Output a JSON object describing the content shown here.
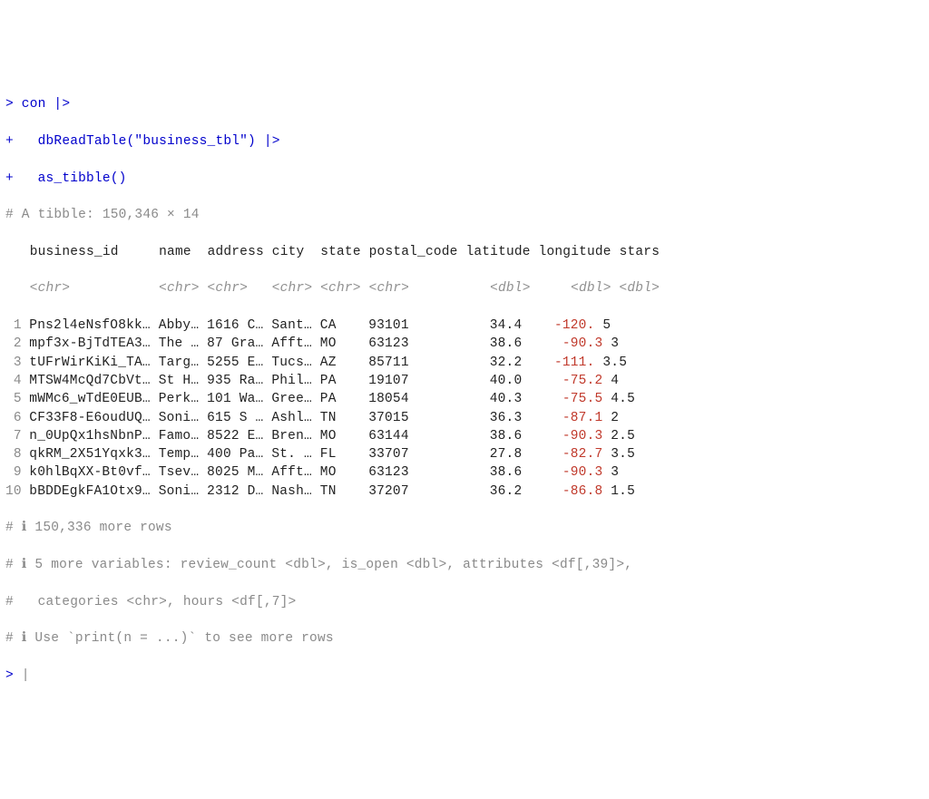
{
  "input": {
    "prompt1": ">",
    "line1": " con |>",
    "prompt2": "+",
    "line2": "   dbReadTable(\"business_tbl\") |>",
    "prompt3": "+",
    "line3": "   as_tibble()"
  },
  "header": {
    "tibble": "# A tibble: 150,346 × 14",
    "cols": {
      "gap0": "   ",
      "business_id": "business_id    ",
      "name": " name ",
      "address": " address",
      "city": " city ",
      "state": " state",
      "postal_code": " postal_code",
      "latitude": " latitude",
      "longitude": " longitude",
      "stars": " stars"
    },
    "types_full": "   <chr>           <chr> <chr>   <chr> <chr> <chr>          <dbl>     <dbl> <dbl>"
  },
  "rows": [
    {
      "n": " 1",
      "biz": " Pns2l4eNsfO8kk…",
      "name": " Abby…",
      "addr": " 1616 C…",
      "city": " Sant…",
      "state": " CA   ",
      "post": " 93101      ",
      "lat": "    34.4",
      "lon": "    -120.",
      "lonneg": true,
      "stars": " 5  "
    },
    {
      "n": " 2",
      "biz": " mpf3x-BjTdTEA3…",
      "name": " The …",
      "addr": " 87 Gra…",
      "city": " Afft…",
      "state": " MO   ",
      "post": " 63123      ",
      "lat": "    38.6",
      "lon": "     -90.3",
      "lonneg": true,
      "stars": " 3  "
    },
    {
      "n": " 3",
      "biz": " tUFrWirKiKi_TA…",
      "name": " Targ…",
      "addr": " 5255 E…",
      "city": " Tucs…",
      "state": " AZ   ",
      "post": " 85711      ",
      "lat": "    32.2",
      "lon": "    -111.",
      "lonneg": true,
      "stars": " 3.5"
    },
    {
      "n": " 4",
      "biz": " MTSW4McQd7CbVt…",
      "name": " St H…",
      "addr": " 935 Ra…",
      "city": " Phil…",
      "state": " PA   ",
      "post": " 19107      ",
      "lat": "    40.0",
      "lon": "     -75.2",
      "lonneg": true,
      "stars": " 4  "
    },
    {
      "n": " 5",
      "biz": " mWMc6_wTdE0EUB…",
      "name": " Perk…",
      "addr": " 101 Wa…",
      "city": " Gree…",
      "state": " PA   ",
      "post": " 18054      ",
      "lat": "    40.3",
      "lon": "     -75.5",
      "lonneg": true,
      "stars": " 4.5"
    },
    {
      "n": " 6",
      "biz": " CF33F8-E6oudUQ…",
      "name": " Soni…",
      "addr": " 615 S …",
      "city": " Ashl…",
      "state": " TN   ",
      "post": " 37015      ",
      "lat": "    36.3",
      "lon": "     -87.1",
      "lonneg": true,
      "stars": " 2  "
    },
    {
      "n": " 7",
      "biz": " n_0UpQx1hsNbnP…",
      "name": " Famo…",
      "addr": " 8522 E…",
      "city": " Bren…",
      "state": " MO   ",
      "post": " 63144      ",
      "lat": "    38.6",
      "lon": "     -90.3",
      "lonneg": true,
      "stars": " 2.5"
    },
    {
      "n": " 8",
      "biz": " qkRM_2X51Yqxk3…",
      "name": " Temp…",
      "addr": " 400 Pa…",
      "city": " St. …",
      "state": " FL   ",
      "post": " 33707      ",
      "lat": "    27.8",
      "lon": "     -82.7",
      "lonneg": true,
      "stars": " 3.5"
    },
    {
      "n": " 9",
      "biz": " k0hlBqXX-Bt0vf…",
      "name": " Tsev…",
      "addr": " 8025 M…",
      "city": " Afft…",
      "state": " MO   ",
      "post": " 63123      ",
      "lat": "    38.6",
      "lon": "     -90.3",
      "lonneg": true,
      "stars": " 3  "
    },
    {
      "n": "10",
      "biz": " bBDDEgkFA1Otx9…",
      "name": " Soni…",
      "addr": " 2312 D…",
      "city": " Nash…",
      "state": " TN   ",
      "post": " 37207      ",
      "lat": "    36.2",
      "lon": "     -86.8",
      "lonneg": true,
      "stars": " 1.5"
    }
  ],
  "footer": {
    "l1": "# ℹ 150,336 more rows",
    "l2": "# ℹ 5 more variables: review_count <dbl>, is_open <dbl>, attributes <df[,39]>,",
    "l3": "#   categories <chr>, hours <df[,7]>",
    "l4": "# ℹ Use `print(n = ...)` to see more rows",
    "prompt": ">",
    "cursor": " |"
  },
  "chart_data": {
    "type": "table",
    "title": "A tibble: 150,346 × 14",
    "columns": [
      "business_id",
      "name",
      "address",
      "city",
      "state",
      "postal_code",
      "latitude",
      "longitude",
      "stars"
    ],
    "column_types": [
      "<chr>",
      "<chr>",
      "<chr>",
      "<chr>",
      "<chr>",
      "<chr>",
      "<dbl>",
      "<dbl>",
      "<dbl>"
    ],
    "rows_shown": 10,
    "total_rows": 150346,
    "more_rows": 150336,
    "more_variables": [
      "review_count <dbl>",
      "is_open <dbl>",
      "attributes <df[,39]>",
      "categories <chr>",
      "hours <df[,7]>"
    ],
    "data": [
      {
        "business_id": "Pns2l4eNsfO8kk…",
        "name": "Abby…",
        "address": "1616 C…",
        "city": "Sant…",
        "state": "CA",
        "postal_code": "93101",
        "latitude": 34.4,
        "longitude": -120,
        "stars": 5
      },
      {
        "business_id": "mpf3x-BjTdTEA3…",
        "name": "The …",
        "address": "87 Gra…",
        "city": "Afft…",
        "state": "MO",
        "postal_code": "63123",
        "latitude": 38.6,
        "longitude": -90.3,
        "stars": 3
      },
      {
        "business_id": "tUFrWirKiKi_TA…",
        "name": "Targ…",
        "address": "5255 E…",
        "city": "Tucs…",
        "state": "AZ",
        "postal_code": "85711",
        "latitude": 32.2,
        "longitude": -111,
        "stars": 3.5
      },
      {
        "business_id": "MTSW4McQd7CbVt…",
        "name": "St H…",
        "address": "935 Ra…",
        "city": "Phil…",
        "state": "PA",
        "postal_code": "19107",
        "latitude": 40.0,
        "longitude": -75.2,
        "stars": 4
      },
      {
        "business_id": "mWMc6_wTdE0EUB…",
        "name": "Perk…",
        "address": "101 Wa…",
        "city": "Gree…",
        "state": "PA",
        "postal_code": "18054",
        "latitude": 40.3,
        "longitude": -75.5,
        "stars": 4.5
      },
      {
        "business_id": "CF33F8-E6oudUQ…",
        "name": "Soni…",
        "address": "615 S …",
        "city": "Ashl…",
        "state": "TN",
        "postal_code": "37015",
        "latitude": 36.3,
        "longitude": -87.1,
        "stars": 2
      },
      {
        "business_id": "n_0UpQx1hsNbnP…",
        "name": "Famo…",
        "address": "8522 E…",
        "city": "Bren…",
        "state": "MO",
        "postal_code": "63144",
        "latitude": 38.6,
        "longitude": -90.3,
        "stars": 2.5
      },
      {
        "business_id": "qkRM_2X51Yqxk3…",
        "name": "Temp…",
        "address": "400 Pa…",
        "city": "St. …",
        "state": "FL",
        "postal_code": "33707",
        "latitude": 27.8,
        "longitude": -82.7,
        "stars": 3.5
      },
      {
        "business_id": "k0hlBqXX-Bt0vf…",
        "name": "Tsev…",
        "address": "8025 M…",
        "city": "Afft…",
        "state": "MO",
        "postal_code": "63123",
        "latitude": 38.6,
        "longitude": -90.3,
        "stars": 3
      },
      {
        "business_id": "bBDDEgkFA1Otx9…",
        "name": "Soni…",
        "address": "2312 D…",
        "city": "Nash…",
        "state": "TN",
        "postal_code": "37207",
        "latitude": 36.2,
        "longitude": -86.8,
        "stars": 1.5
      }
    ]
  }
}
